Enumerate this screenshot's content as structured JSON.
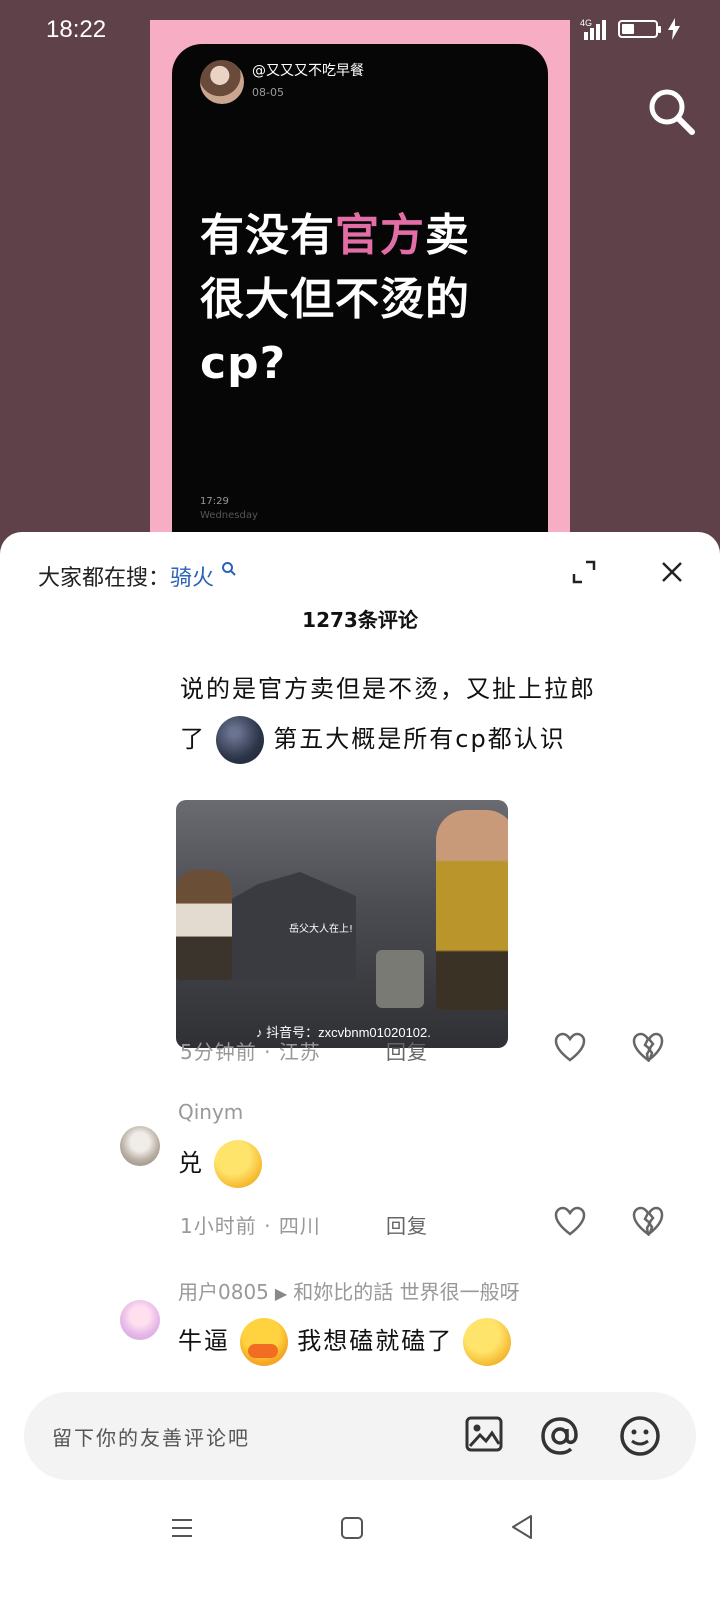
{
  "status_bar": {
    "time": "18:22",
    "network": "4G",
    "hd": "HD"
  },
  "post": {
    "username": "@又又又不吃早餐",
    "date": "08-05",
    "headline_before": "有没有",
    "headline_highlight": "官方",
    "headline_after": "卖很大但不烫的cp?",
    "time": "17:29",
    "day": "Wednesday"
  },
  "sheet": {
    "hot_search_label": "大家都在搜：",
    "hot_search_keyword": "骑火",
    "comment_count": "1273条评论"
  },
  "comments": [
    {
      "text_line1": "说的是官方卖但是不烫，又扯上拉郎",
      "text_line2_before": "了",
      "text_line2_after": "第五大概是所有cp都认识",
      "video_caption": "岳父大人在上!",
      "video_watermark": "抖音号：zxcvbnm01020102.",
      "time": "5分钟前",
      "location": "江苏",
      "reply": "回复"
    }
  ],
  "replies": [
    {
      "username": "Qinym",
      "text": "兑",
      "time": "1小时前",
      "location": "四川",
      "reply": "回复"
    },
    {
      "username": "用户0805",
      "reply_to": "和妳比的話 世界很一般呀",
      "text_before": "牛逼",
      "text_after": "我想磕就磕了"
    }
  ],
  "input": {
    "placeholder": "留下你的友善评论吧"
  },
  "colors": {
    "pink_frame": "#f7aec4",
    "highlight": "#e36ea7",
    "keyword": "#2c62b8",
    "backdrop": "#5e4149"
  }
}
